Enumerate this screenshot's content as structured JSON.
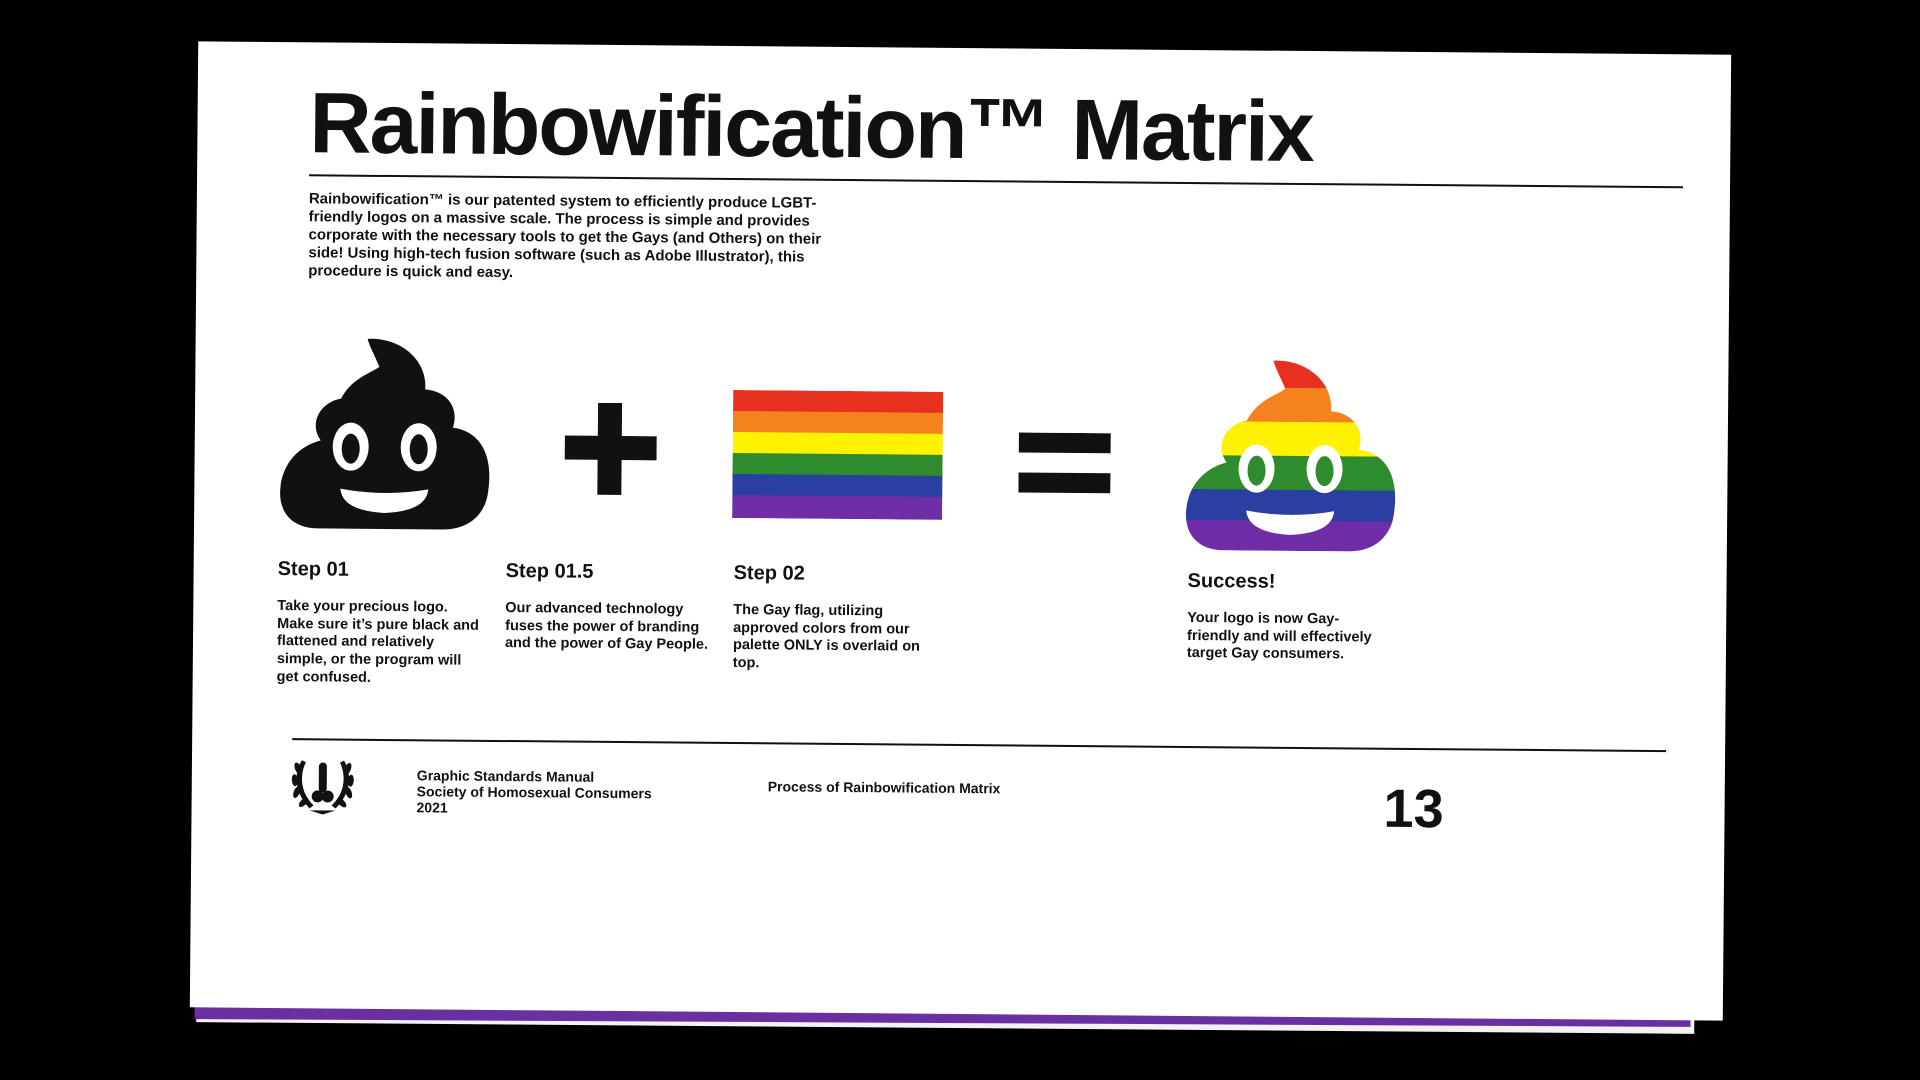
{
  "title": "Rainbowification™ Matrix",
  "intro": "Rainbowification™ is our patented system to efficiently produce LGBT-friendly logos on a massive scale. The process is simple and provides corporate with the necessary tools to get the Gays (and Others) on their side! Using high-tech fusion software (such as Adobe Illustrator), this procedure is quick and easy.",
  "colors": {
    "ink": "#111111",
    "flag": [
      "#e8301f",
      "#f5821f",
      "#fff200",
      "#2e8b2e",
      "#2a3fa0",
      "#6f2da8"
    ]
  },
  "icons": {
    "logo_black": "pile-of-poo-icon",
    "plus": "plus-icon",
    "flag": "rainbow-flag-icon",
    "equals": "equals-icon",
    "logo_rainbow": "rainbow-pile-of-poo-icon",
    "crest": "laurel-crest-icon"
  },
  "steps": [
    {
      "title": "Step 01",
      "text": "Take your precious logo. Make sure it’s pure black and flattened and relatively simple, or the program will get confused."
    },
    {
      "title": "Step 01.5",
      "text": "Our advanced technology fuses the power of branding and the power of Gay People."
    },
    {
      "title": "Step 02",
      "text": "The Gay flag, utilizing approved colors from our palette ONLY is overlaid on top."
    },
    {
      "title": "Success!",
      "text": "Your logo is now Gay-friendly and will effectively target Gay consumers."
    }
  ],
  "footer": {
    "manual": "Graphic Standards Manual",
    "society": "Society of Homosexual Consumers",
    "year": "2021",
    "section": "Process of Rainbowification Matrix",
    "page_number": "13"
  }
}
